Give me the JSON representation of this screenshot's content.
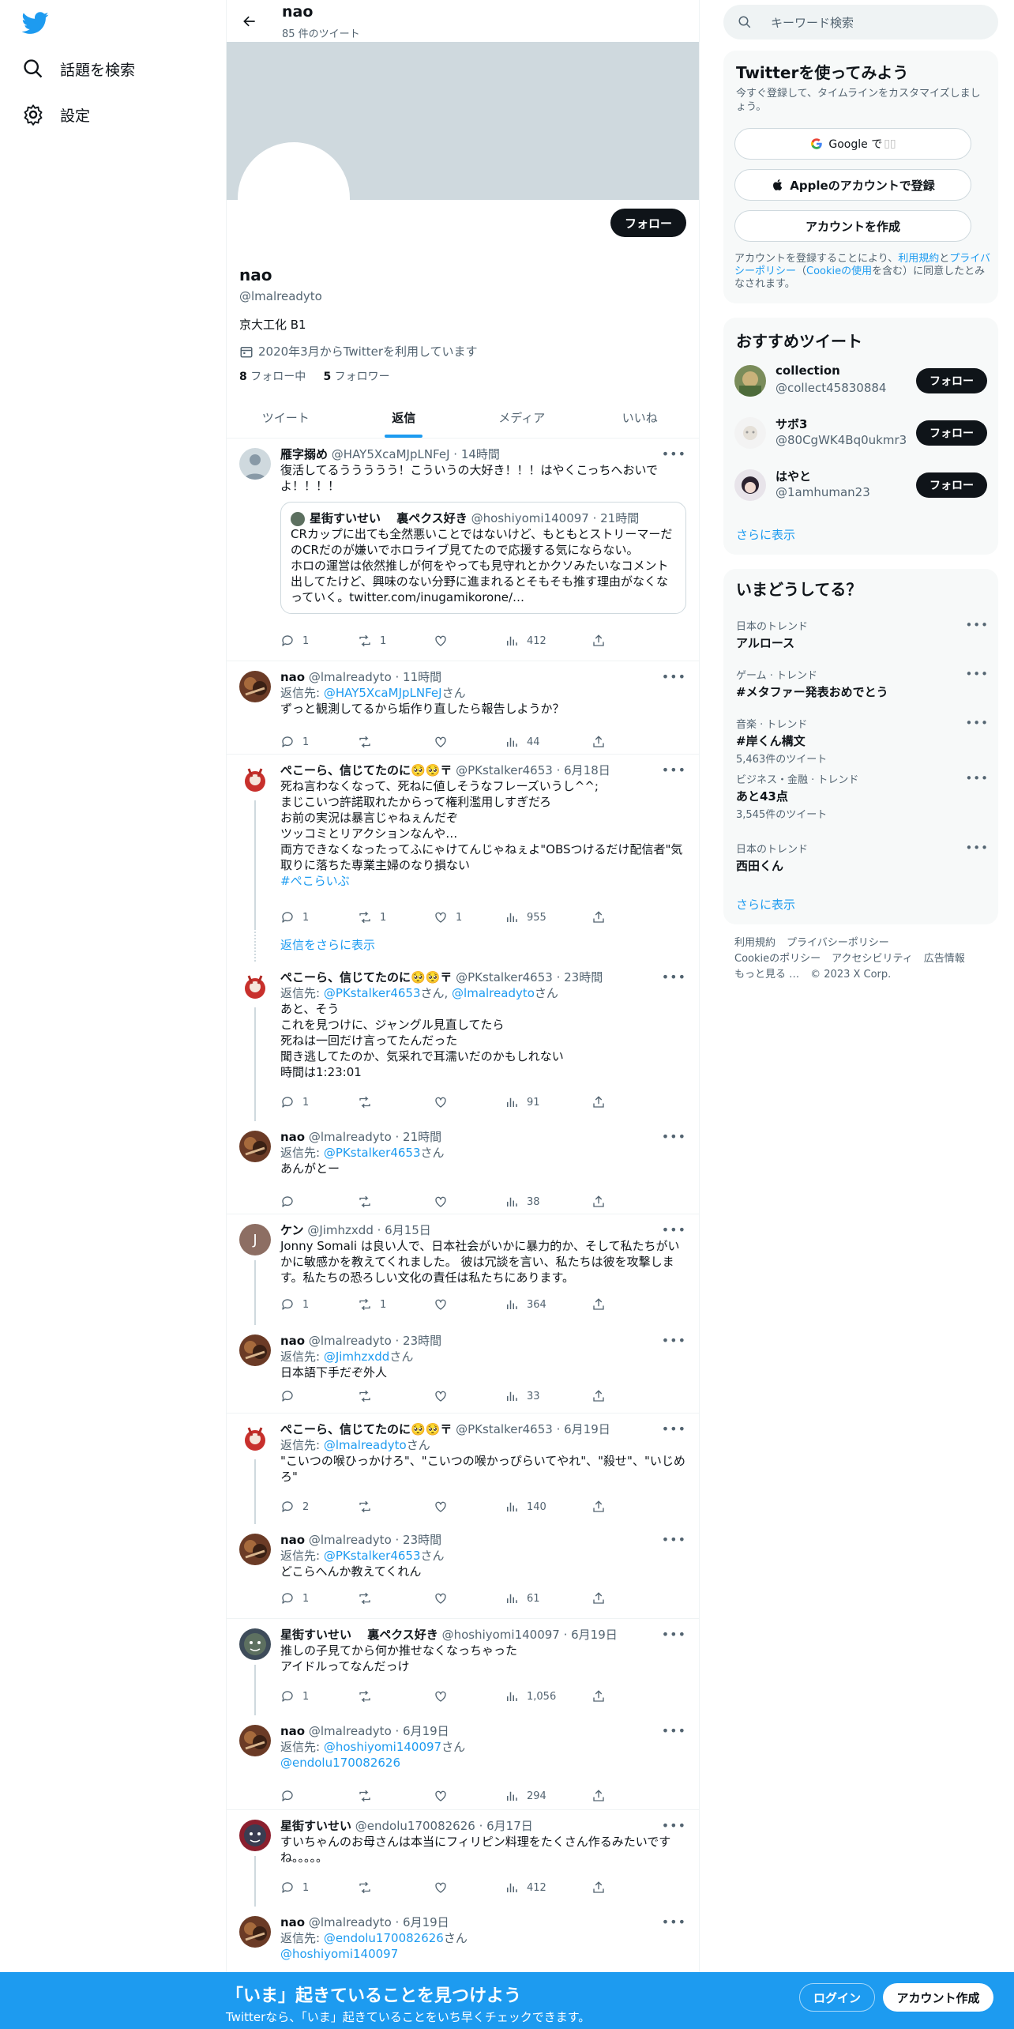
{
  "nav": {
    "explore_label": "話題を検索",
    "settings_label": "設定"
  },
  "profile": {
    "header_name": "nao",
    "tweet_count": "85 件のツイート",
    "follow_label": "フォロー",
    "name": "nao",
    "handle": "@lmalreadyto",
    "bio": "京大工化 B1",
    "joined": "2020年3月からTwitterを利用しています",
    "following_count": "8",
    "following_label": " フォロー中",
    "followers_count": "5",
    "followers_label": " フォロワー",
    "tabs": [
      "ツイート",
      "返信",
      "メディア",
      "いいね"
    ]
  },
  "tweets": [
    {
      "name": "雁字搦め",
      "meta": "@HAY5XcaMJpLNFeJ · 14時間",
      "text": "復活してるううううう！こういうの大好き！！！はやくこっちへおいでよ！！！！",
      "quote": {
        "name": "星街すいせい　 裏ペクス好き",
        "meta": "@hoshiyomi140097 · 21時間",
        "text": "CRカップに出ても全然悪いことではないけど、もともとストリーマーだのCRだのが嫌いでホロライブ見てたので応援する気にならない。\nホロの運営は依然推しが何をやっても見守れとかクソみたいなコメント出してたけど、興味のない分野に進まれるとそもそも推す理由がなくなっていく。twitter.com/inugamikorone/…"
      },
      "counts": {
        "reply": "1",
        "retweet": "1",
        "like": "",
        "views": "412"
      }
    },
    {
      "name": "nao",
      "meta": "@lmalreadyto · 11時間",
      "reply_to": "@HAY5XcaMJpLNFeJ",
      "reply_suffix": "さん",
      "text": "ずっと観測してるから垢作り直したら報告しようか？",
      "counts": {
        "reply": "1",
        "retweet": "",
        "like": "",
        "views": "44"
      }
    },
    {
      "name": "ぺこーら、信じてたのに🥺🥺〒",
      "meta": "@PKstalker4653 · 6月18日",
      "text": "死ね言わなくなって、死ねに値しそうなフレーズいうし^^;\nまじこいつ許諾取れたからって権利濫用しすぎだろ\nお前の実況は暴言じゃねぇんだぞ\nツッコミとリアクションなんや…\n両方できなくなったってふにゃけてんじゃねぇよ\"OBSつけるだけ配信者\"気取りに落ちた専業主婦のなり損ない",
      "hashtag": "#ぺこらいぶ",
      "counts": {
        "reply": "1",
        "retweet": "1",
        "like": "1",
        "views": "955"
      }
    },
    {
      "more_replies": "返信をさらに表示"
    },
    {
      "name": "ぺこーら、信じてたのに🥺🥺〒",
      "meta": "@PKstalker4653 · 23時間",
      "reply_to": "@PKstalker4653",
      "reply_mid": "さん, ",
      "reply_to2": "@lmalreadyto",
      "reply_suffix": "さん",
      "text": "あと、そう\nこれを見つけに、ジャングル見直してたら\n死ねは一回だけ言ってたんだった\n聞き逃してたのか、気采れで耳濡いだのかもしれない\n時間は1:23:01",
      "counts": {
        "reply": "1",
        "retweet": "",
        "like": "",
        "views": "91"
      }
    },
    {
      "name": "nao",
      "meta": "@lmalreadyto · 21時間",
      "reply_to": "@PKstalker4653",
      "reply_suffix": "さん",
      "text": "あんがとー",
      "counts": {
        "reply": "",
        "retweet": "",
        "like": "",
        "views": "38"
      }
    },
    {
      "name": "ケン",
      "meta": "@Jimhzxdd · 6月15日",
      "avatar_letter": "J",
      "text": "Jonny Somali は良い人で、日本社会がいかに暴力的か、そして私たちがいかに敏感かを教えてくれました。 彼は冗談を言い、私たちは彼を攻撃します。私たちの恐ろしい文化の責任は私たちにあります。",
      "counts": {
        "reply": "1",
        "retweet": "1",
        "like": "",
        "views": "364"
      }
    },
    {
      "name": "nao",
      "meta": "@lmalreadyto · 23時間",
      "reply_to": "@Jimhzxdd",
      "reply_suffix": "さん",
      "text": "日本語下手だぞ外人",
      "counts": {
        "reply": "",
        "retweet": "",
        "like": "",
        "views": "33"
      }
    },
    {
      "name": "ぺこーら、信じてたのに🥺🥺〒",
      "meta": "@PKstalker4653 · 6月19日",
      "reply_to": "@lmalreadyto",
      "reply_suffix": "さん",
      "text": "\"こいつの喉ひっかけろ\"、\"こいつの喉かっぴらいてやれ\"、\"殺せ\"、\"いじめろ\"",
      "counts": {
        "reply": "2",
        "retweet": "",
        "like": "",
        "views": "140"
      }
    },
    {
      "name": "nao",
      "meta": "@lmalreadyto · 23時間",
      "reply_to": "@PKstalker4653",
      "reply_suffix": "さん",
      "text": "どこらへんか教えてくれん",
      "counts": {
        "reply": "1",
        "retweet": "",
        "like": "",
        "views": "61"
      }
    },
    {
      "name": "星街すいせい　 裏ペクス好き",
      "meta": "@hoshiyomi140097 · 6月19日",
      "text": "推しの子見てから何か推せなくなっちゃった\nアイドルってなんだっけ",
      "counts": {
        "reply": "1",
        "retweet": "",
        "like": "",
        "views": "1,056"
      }
    },
    {
      "name": "nao",
      "meta": "@lmalreadyto · 6月19日",
      "reply_to": "@hoshiyomi140097",
      "reply_suffix": "さん",
      "reply_line2": "@endolu170082626",
      "text": "",
      "counts": {
        "reply": "",
        "retweet": "",
        "like": "",
        "views": "294"
      }
    },
    {
      "name": "星街すいせい",
      "meta": "@endolu170082626 · 6月17日",
      "text": "すいちゃんのお母さんは本当にフィリピン料理をたくさん作るみたいですね。。。。。",
      "counts": {
        "reply": "1",
        "retweet": "",
        "like": "",
        "views": "412"
      }
    },
    {
      "name": "nao",
      "meta": "@lmalreadyto · 6月19日",
      "reply_to": "@endolu170082626",
      "reply_suffix": "さん",
      "reply_line2": "@hoshiyomi140097",
      "text": ""
    }
  ],
  "right": {
    "search_placeholder": "キーワード検索",
    "signup": {
      "title": "Twitterを使ってみよう",
      "sub": "今すぐ登録して、タイムラインをカスタマイズしましょう。",
      "google": "Google で",
      "apple": "Appleのアカウントで登録",
      "create": "アカウントを作成",
      "legal_1": "アカウントを登録することにより、",
      "legal_terms": "利用規約",
      "legal_2": "と",
      "legal_privacy": "プライバシーポリシー",
      "legal_3": "（",
      "legal_cookie": "Cookieの使用",
      "legal_4": "を含む）に同意したとみなされます。"
    },
    "who_to_follow": {
      "title": "おすすめツイート",
      "users": [
        {
          "name": "collection",
          "handle": "@collect45830884",
          "follow": "フォロー"
        },
        {
          "name": "サボ3",
          "handle": "@80CgWK4Bq0ukmr3",
          "follow": "フォロー"
        },
        {
          "name": "はやと",
          "handle": "@1amhuman23",
          "follow": "フォロー"
        }
      ],
      "show_more": "さらに表示"
    },
    "trends": {
      "title": "いまどうしてる？",
      "items": [
        {
          "context": "日本のトレンド",
          "name": "アルロース",
          "count": ""
        },
        {
          "context": "ゲーム · トレンド",
          "name": "#メタファー発表おめでとう",
          "count": ""
        },
        {
          "context": "音楽 · トレンド",
          "name": "#岸くん構文",
          "count": "5,463件のツイート"
        },
        {
          "context": "ビジネス・金融 · トレンド",
          "name": "あと43点",
          "count": "3,545件のツイート"
        },
        {
          "context": "日本のトレンド",
          "name": "西田くん",
          "count": ""
        }
      ],
      "show_more": "さらに表示"
    },
    "footer": {
      "terms": "利用規約",
      "privacy": "プライバシーポリシー",
      "cookie": "Cookieのポリシー",
      "accessibility": "アクセシビリティ",
      "ads": "広告情報",
      "more": "もっと見る …",
      "copyright": "© 2023 X Corp."
    }
  },
  "bottom": {
    "title": "「いま」起きていることを見つけよう",
    "sub": "Twitterなら、「いま」起きていることをいち早くチェックできます。",
    "login": "ログイン",
    "signup": "アカウント作成"
  },
  "colors": {
    "accent": "#1d9bf0",
    "text": "#0f1419",
    "muted": "#536471",
    "border": "#eff3f4",
    "banner": "#cfd9de"
  }
}
